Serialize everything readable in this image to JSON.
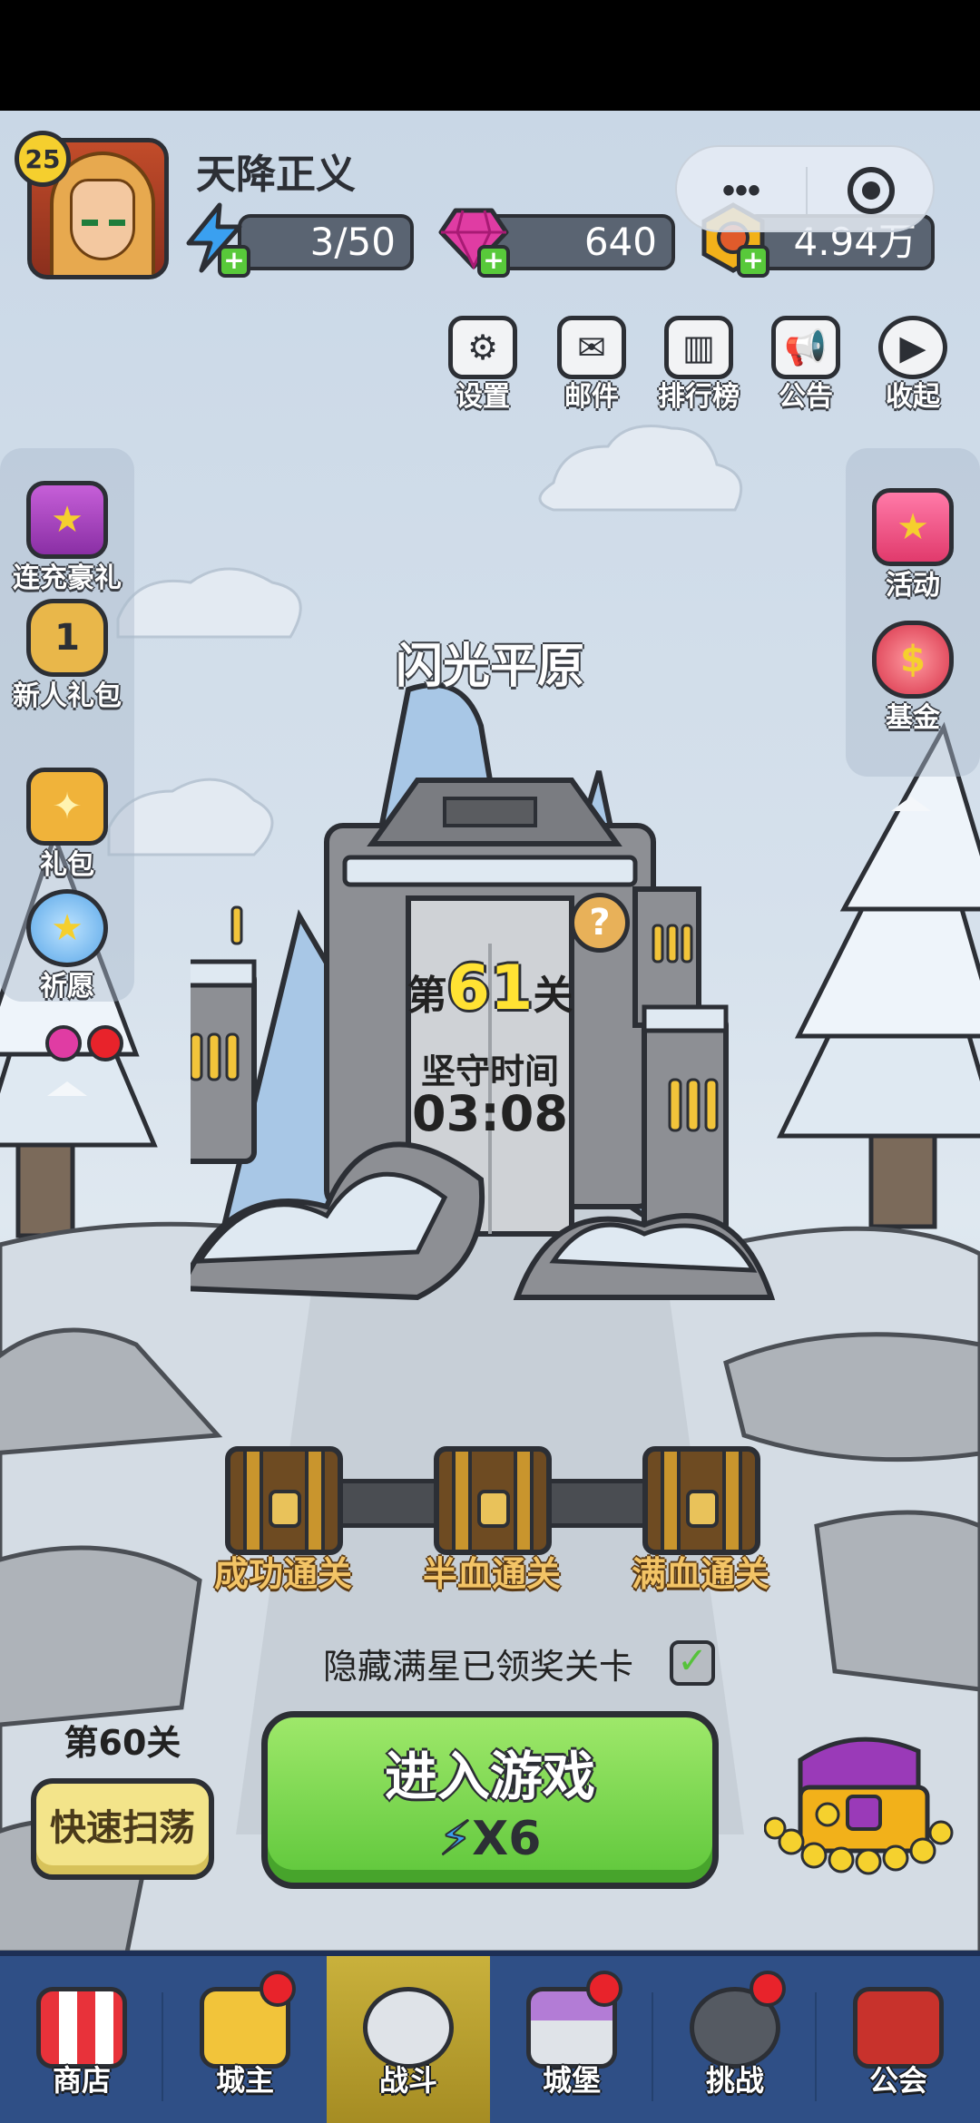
{
  "player": {
    "level": "25",
    "name": "天降正义"
  },
  "resources": {
    "energy": "3/50",
    "gems": "640",
    "gold": "4.94万"
  },
  "capsule": {
    "menu_icon": "more-dots-icon",
    "close_icon": "target-circle-icon"
  },
  "top_buttons": [
    {
      "label": "设置",
      "icon": "gear-icon"
    },
    {
      "label": "邮件",
      "icon": "mail-icon"
    },
    {
      "label": "排行榜",
      "icon": "leaderboard-icon"
    },
    {
      "label": "公告",
      "icon": "megaphone-icon"
    },
    {
      "label": "收起",
      "icon": "collapse-play-icon"
    }
  ],
  "left_side": [
    {
      "label": "连充豪礼",
      "icon": "gift-box-icon"
    },
    {
      "label": "新人礼包",
      "icon": "pentagon-badge-icon",
      "badge": "1"
    },
    {
      "label": "礼包",
      "icon": "gift-icon"
    },
    {
      "label": "祈愿",
      "icon": "wish-globe-icon"
    }
  ],
  "right_side": [
    {
      "label": "活动",
      "icon": "star-gift-icon"
    },
    {
      "label": "基金",
      "icon": "money-bag-icon"
    }
  ],
  "stage": {
    "area_name": "闪光平原",
    "prefix": "第",
    "number": "61",
    "suffix": "关",
    "hold_label": "坚守时间",
    "hold_time": "03:08",
    "help_glyph": "?"
  },
  "chests": [
    {
      "label": "成功通关"
    },
    {
      "label": "半血通关"
    },
    {
      "label": "满血通关"
    }
  ],
  "hidden_toggle": {
    "label": "隐藏满星已领奖关卡",
    "checked": true
  },
  "sweep": {
    "level_label": "第60关",
    "button": "快速扫荡"
  },
  "enter_game": {
    "label": "进入游戏",
    "cost": "X6"
  },
  "nav": [
    {
      "label": "商店",
      "icon": "shop-icon",
      "dot": false,
      "active": false
    },
    {
      "label": "城主",
      "icon": "crown-icon",
      "dot": true,
      "active": false
    },
    {
      "label": "战斗",
      "icon": "crossed-swords-icon",
      "dot": false,
      "active": true
    },
    {
      "label": "城堡",
      "icon": "castle-icon",
      "dot": true,
      "active": false
    },
    {
      "label": "挑战",
      "icon": "demon-icon",
      "dot": true,
      "active": false
    },
    {
      "label": "公会",
      "icon": "guild-banner-icon",
      "dot": false,
      "active": false
    }
  ],
  "colors": {
    "accent_green": "#5fc73b",
    "nav_blue": "#2f4f86",
    "nav_active": "#c9b13c",
    "gem_pink": "#e03ca3",
    "energy_blue": "#3aa0f0",
    "gold": "#f2b11a"
  }
}
